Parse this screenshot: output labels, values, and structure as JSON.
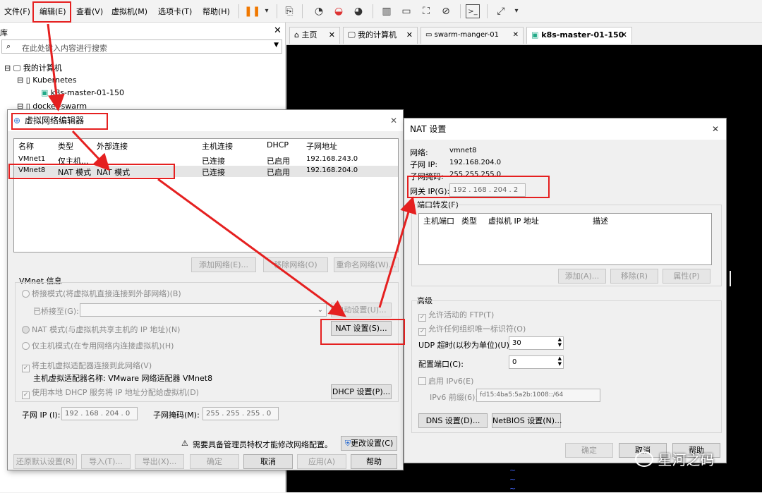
{
  "menubar": {
    "file": "文件(F)",
    "edit": "编辑(E)",
    "view": "查看(V)",
    "vm": "虚拟机(M)",
    "tabs": "选项卡(T)",
    "help": "帮助(H)"
  },
  "library": {
    "title": "库",
    "search_placeholder": "在此处键入内容进行搜索",
    "my_computer": "我的计算机",
    "kubernetes": "Kubernetes",
    "k8s_master": "k8s-master-01-150",
    "docker_swarm": "docker-swarm"
  },
  "tabs": [
    {
      "label": "主页"
    },
    {
      "label": "我的计算机"
    },
    {
      "label": "swarm-manger-01"
    },
    {
      "label": "k8s-master-01-150"
    }
  ],
  "vne": {
    "title": "虚拟网络编辑器",
    "columns": [
      "名称",
      "类型",
      "外部连接",
      "主机连接",
      "DHCP",
      "子网地址"
    ],
    "rows": [
      {
        "name": "VMnet1",
        "type": "仅主机...",
        "ext": "-",
        "host": "已连接",
        "dhcp": "已启用",
        "subnet": "192.168.243.0"
      },
      {
        "name": "VMnet8",
        "type": "NAT 模式",
        "ext": "NAT 模式",
        "host": "已连接",
        "dhcp": "已启用",
        "subnet": "192.168.204.0"
      }
    ],
    "add_network": "添加网络(E)...",
    "remove_network": "移除网络(O)",
    "rename_network": "重命名网络(W)...",
    "vmnet_info": "VMnet 信息",
    "bridged": "桥接模式(将虚拟机直接连接到外部网络)(B)",
    "bridged_to": "已桥接至(G):",
    "auto_settings": "自动设置(U)...",
    "nat_mode": "NAT 模式(与虚拟机共享主机的 IP 地址)(N)",
    "nat_settings": "NAT 设置(S)...",
    "host_only": "仅主机模式(在专用网络内连接虚拟机)(H)",
    "connect_adapter": "将主机虚拟适配器连接到此网络(V)",
    "adapter_name": "主机虚拟适配器名称: VMware 网络适配器 VMnet8",
    "use_dhcp": "使用本地 DHCP 服务将 IP 地址分配给虚拟机(D)",
    "dhcp_settings": "DHCP 设置(P)...",
    "subnet_ip_label": "子网 IP (I):",
    "subnet_ip": "192 . 168 . 204 . 0",
    "subnet_mask_label": "子网掩码(M):",
    "subnet_mask": "255 . 255 . 255 . 0",
    "admin_warning": "需要具备管理员特权才能修改网络配置。",
    "change_settings": "更改设置(C)",
    "restore_defaults": "还原默认设置(R)",
    "import": "导入(T)...",
    "export": "导出(X)...",
    "ok": "确定",
    "cancel": "取消",
    "apply": "应用(A)",
    "help": "帮助"
  },
  "nat": {
    "title": "NAT 设置",
    "network_label": "网络:",
    "network": "vmnet8",
    "subnet_ip_label": "子网 IP:",
    "subnet_ip": "192.168.204.0",
    "subnet_mask_label": "子网掩码:",
    "subnet_mask": "255.255.255.0",
    "gateway_label": "网关 IP(G):",
    "gateway": "192 . 168 . 204 . 2",
    "port_forwarding": "端口转发(F)",
    "columns": [
      "主机端口",
      "类型",
      "虚拟机 IP 地址",
      "描述"
    ],
    "add": "添加(A)...",
    "remove": "移除(R)",
    "properties": "属性(P)",
    "advanced": "高级",
    "allow_ftp": "允许活动的 FTP(T)",
    "allow_uid": "允许任何组织唯一标识符(O)",
    "udp_timeout_label": "UDP 超时(以秒为单位)(U):",
    "udp_timeout": "30",
    "config_port_label": "配置端口(C):",
    "config_port": "0",
    "enable_ipv6": "启用 IPv6(E)",
    "ipv6_prefix_label": "IPv6 前缀(6):",
    "ipv6_prefix": "fd15:4ba5:5a2b:1008::/64",
    "dns_settings": "DNS 设置(D)...",
    "netbios_settings": "NetBIOS 设置(N)...",
    "ok": "确定",
    "cancel": "取消",
    "help": "帮助"
  },
  "watermark": "星河之码"
}
